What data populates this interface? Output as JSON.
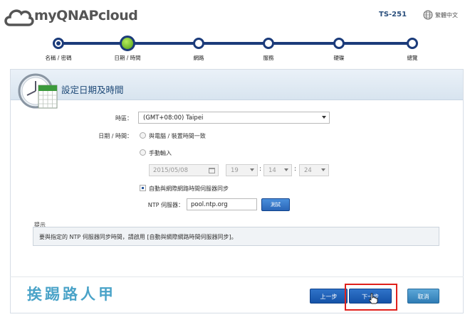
{
  "header": {
    "logo": "myQNAPcloud",
    "device": "TS-251",
    "language": "繁體中文"
  },
  "steps": [
    {
      "label": "名稱 / 密碼",
      "state": "done"
    },
    {
      "label": "日期 / 時間",
      "state": "current"
    },
    {
      "label": "網路",
      "state": "todo"
    },
    {
      "label": "服務",
      "state": "todo"
    },
    {
      "label": "硬碟",
      "state": "todo"
    },
    {
      "label": "總覽",
      "state": "todo"
    }
  ],
  "panel": {
    "title": "設定日期及時間",
    "timezone_label": "時區：",
    "timezone_value": "(GMT+08:00) Taipei",
    "datetime_label": "日期 / 時間：",
    "opt_sync_pc": "與電腦 / 裝置時間一致",
    "opt_manual": "手動輸入",
    "date_value": "2015/05/08",
    "hour": "19",
    "minute": "14",
    "second": "24",
    "colon": ":",
    "opt_ntp": "自動與網際網路時間伺服器同步",
    "ntp_label": "NTP 伺服器：",
    "ntp_value": "pool.ntp.org",
    "test_button": "測試"
  },
  "hint": {
    "title": "提示",
    "text": "要與指定的 NTP 伺服器同步時間，請啟用 [自動與網際網路時間伺服器同步]。"
  },
  "footer": {
    "prev_button": "上一步",
    "next_button": "下一步",
    "cancel_button": "取消",
    "watermark": "挨踢路人甲"
  },
  "colors": {
    "accent": "#1b3b7a",
    "button": "#1553a8",
    "current_step": "#4e9c14",
    "highlight": "#e0201b"
  }
}
